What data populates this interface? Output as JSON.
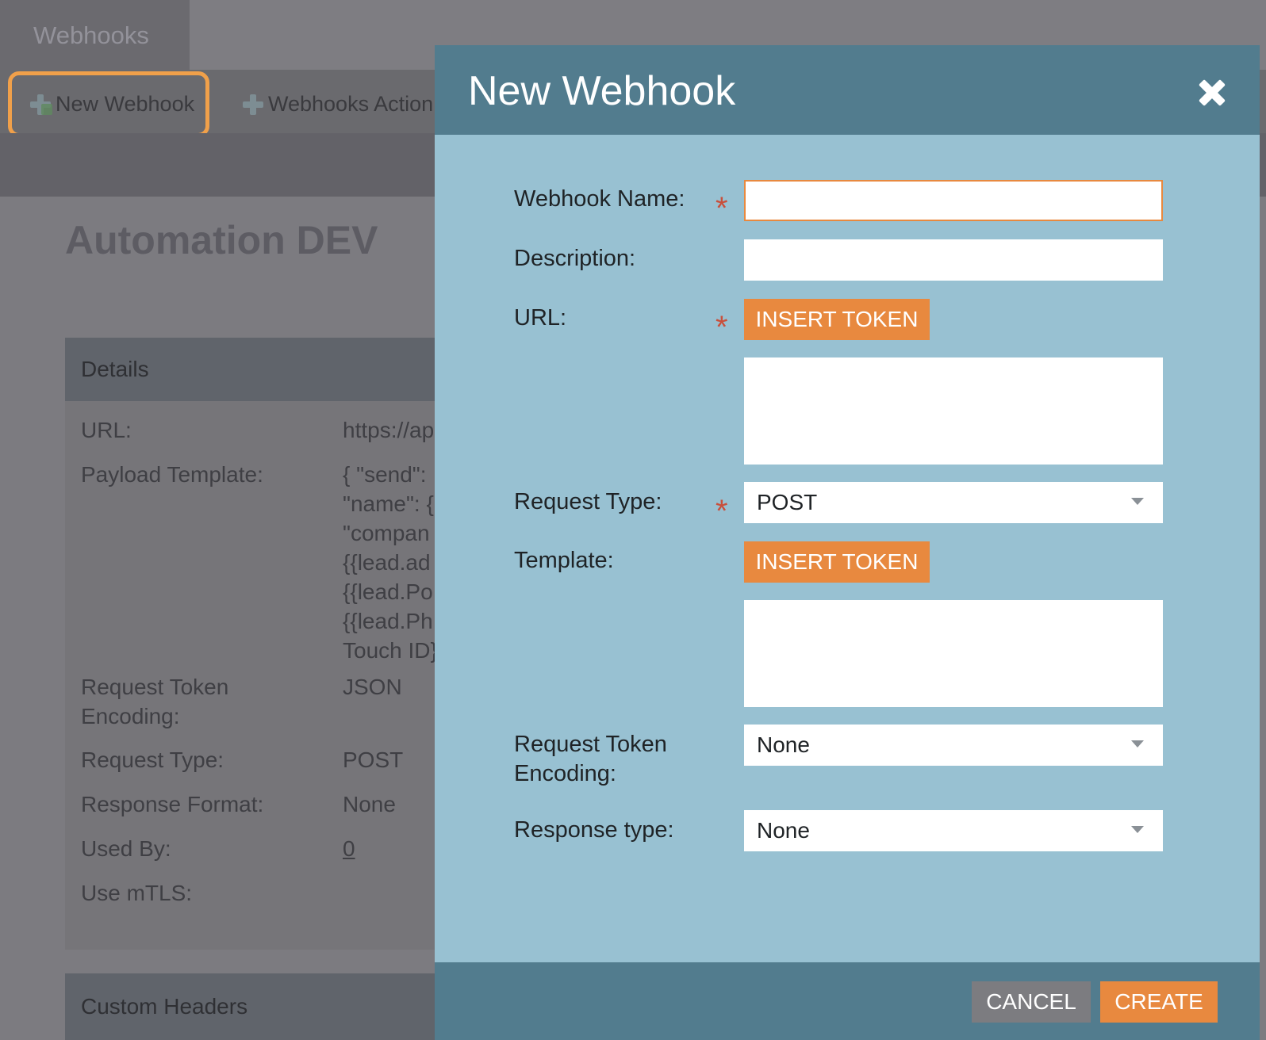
{
  "background": {
    "tab_label": "Webhooks",
    "toolbar": {
      "new_webhook": "New Webhook",
      "webhooks_actions": "Webhooks Action"
    },
    "page_title": "Automation DEV",
    "details": {
      "header": "Details",
      "rows": [
        {
          "label": "URL:",
          "value": "https://ap"
        },
        {
          "label": "Payload Template:",
          "value": "{ \"send\":\n\"name\": {\n\"compan\n{{lead.ad\n{{lead.Po\n{{lead.Ph\nTouch ID}"
        },
        {
          "label": "Request Token\nEncoding:",
          "value": "JSON"
        },
        {
          "label": "Request Type:",
          "value": "POST"
        },
        {
          "label": "Response Format:",
          "value": "None"
        },
        {
          "label": "Used By:",
          "value": "0"
        },
        {
          "label": "Use mTLS:",
          "value": ""
        }
      ]
    },
    "custom_headers": "Custom Headers"
  },
  "modal": {
    "title": "New Webhook",
    "fields": {
      "webhook_name": {
        "label": "Webhook Name:",
        "value": "",
        "required": true
      },
      "description": {
        "label": "Description:",
        "value": ""
      },
      "url": {
        "label": "URL:",
        "token_button": "INSERT TOKEN",
        "value": "",
        "required": true
      },
      "request_type": {
        "label": "Request Type:",
        "value": "POST",
        "required": true
      },
      "template": {
        "label": "Template:",
        "token_button": "INSERT TOKEN",
        "value": ""
      },
      "request_token_encoding": {
        "label": "Request Token\nEncoding:",
        "value": "None"
      },
      "response_type": {
        "label": "Response type:",
        "value": "None"
      }
    },
    "required_marker": "*",
    "buttons": {
      "cancel": "CANCEL",
      "create": "CREATE"
    }
  },
  "colors": {
    "accent_orange": "#e8893f",
    "modal_header": "#527c8e",
    "modal_body": "#98c1d2",
    "required_red": "#c94f3b",
    "highlight_ring": "#f0a04a"
  }
}
